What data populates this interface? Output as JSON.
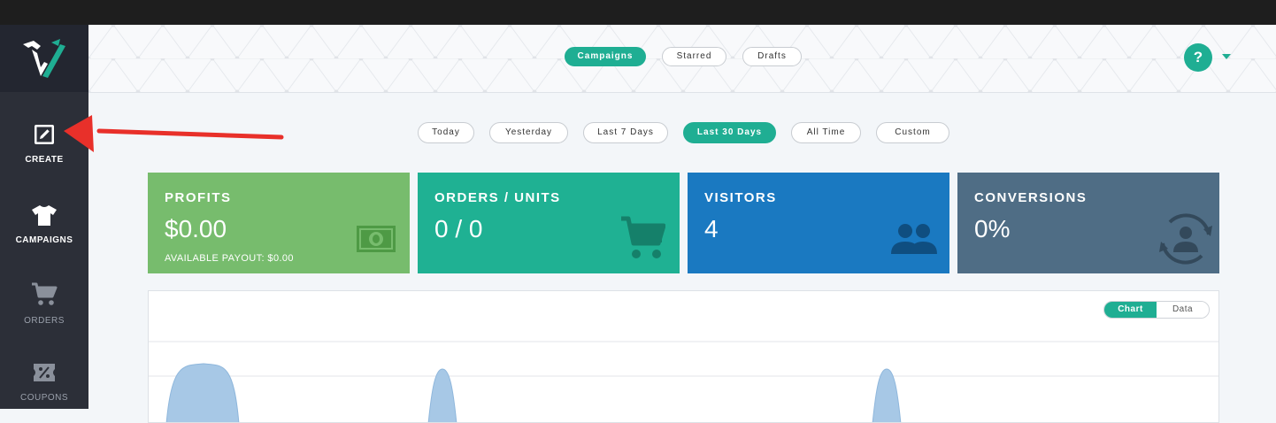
{
  "header_tabs": [
    {
      "label": "Campaigns",
      "active": true
    },
    {
      "label": "Starred",
      "active": false
    },
    {
      "label": "Drafts",
      "active": false
    }
  ],
  "help": {
    "label": "?"
  },
  "sidebar": {
    "items": [
      {
        "label": "CREATE",
        "icon": "edit-icon",
        "highlighted": true
      },
      {
        "label": "CAMPAIGNS",
        "icon": "tshirt-icon",
        "highlighted": true
      },
      {
        "label": "ORDERS",
        "icon": "cart-icon",
        "highlighted": false
      },
      {
        "label": "COUPONS",
        "icon": "coupon-icon",
        "highlighted": false
      }
    ]
  },
  "date_filters": [
    {
      "label": "Today",
      "active": false
    },
    {
      "label": "Yesterday",
      "active": false
    },
    {
      "label": "Last 7 Days",
      "active": false
    },
    {
      "label": "Last 30 Days",
      "active": true
    },
    {
      "label": "All Time",
      "active": false
    },
    {
      "label": "Custom",
      "active": false
    }
  ],
  "stats": {
    "profits": {
      "title": "PROFITS",
      "value": "$0.00",
      "sub": "AVAILABLE PAYOUT: $0.00",
      "color": "#77bc6d",
      "icon": "money-icon"
    },
    "orders": {
      "title": "ORDERS / UNITS",
      "value": "0 / 0",
      "color": "#1fb193",
      "icon": "cart-icon"
    },
    "visitors": {
      "title": "VISITORS",
      "value": "4",
      "color": "#1a79c1",
      "icon": "people-icon"
    },
    "conversions": {
      "title": "CONVERSIONS",
      "value": "0%",
      "color": "#4f6d85",
      "icon": "user-refresh-icon"
    }
  },
  "chart_view": {
    "chart_label": "Chart",
    "data_label": "Data",
    "active": "Chart"
  },
  "colors": {
    "accent": "#1fae93",
    "sidebar": "#2c2f38",
    "annotation_arrow": "#e8302a",
    "chart_fill": "#a7c8e6"
  }
}
